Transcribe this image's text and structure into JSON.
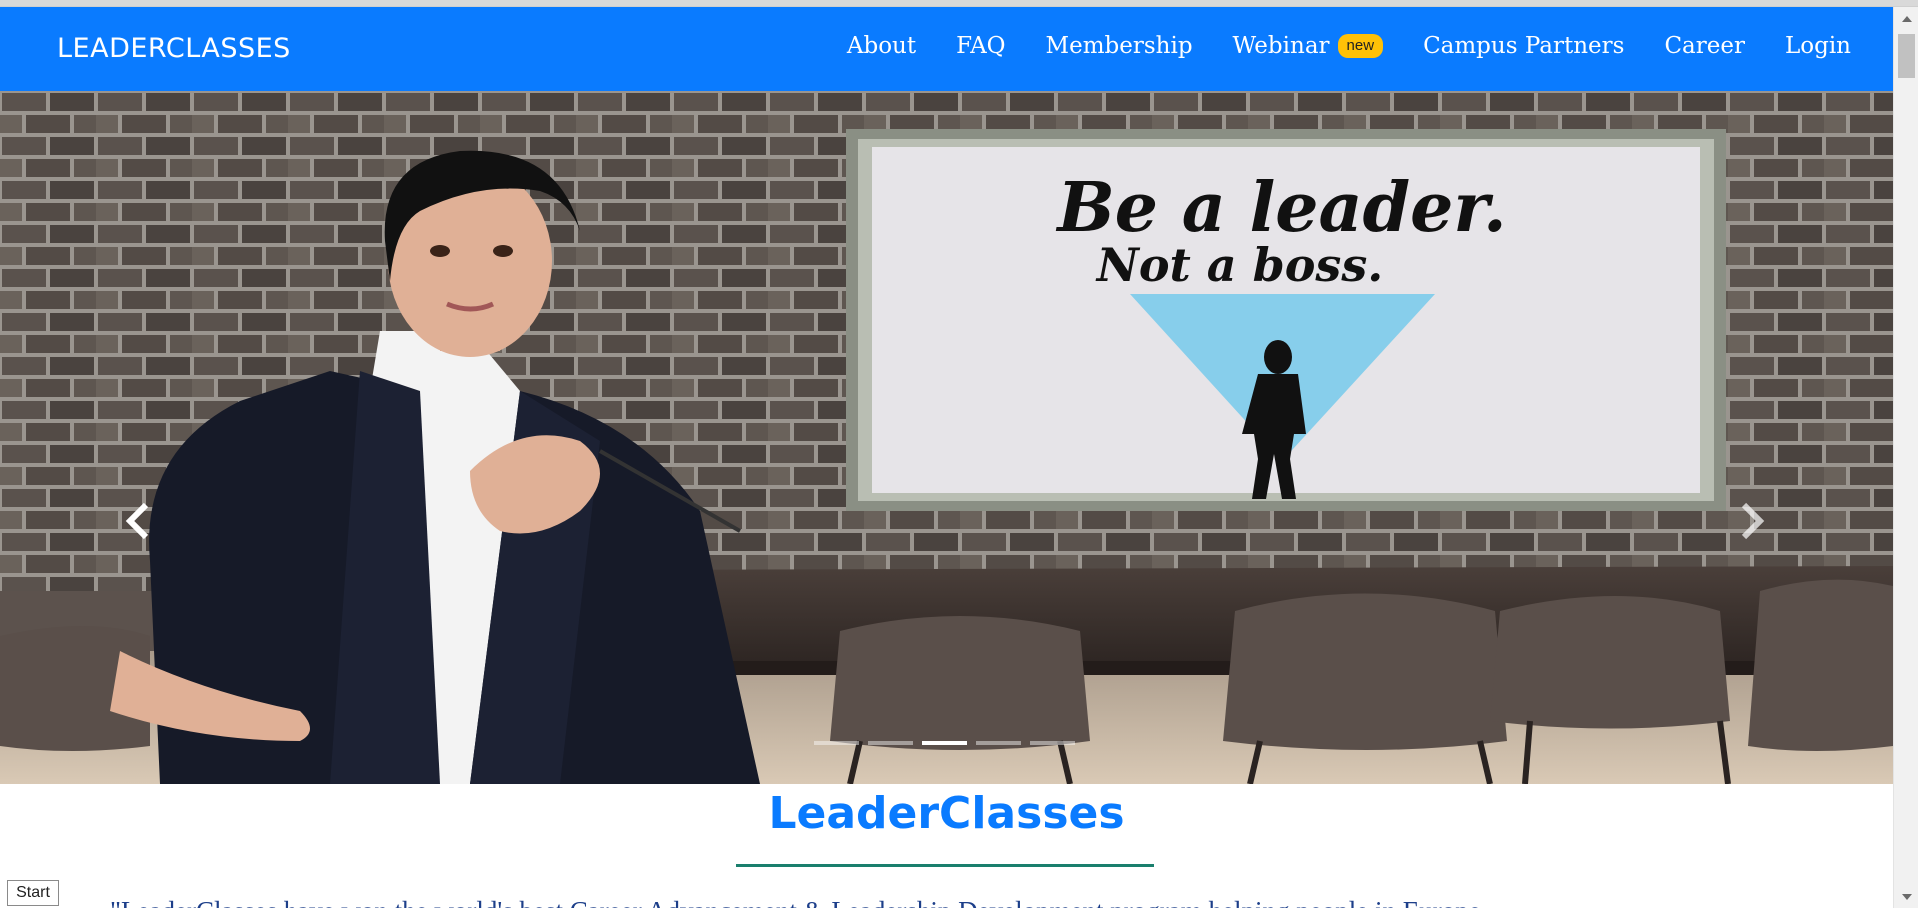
{
  "brand": {
    "name": "LEADERCLASSES"
  },
  "nav": {
    "items": [
      {
        "label": "About"
      },
      {
        "label": "FAQ"
      },
      {
        "label": "Membership"
      },
      {
        "label": "Webinar",
        "badge": "new"
      },
      {
        "label": "Campus Partners"
      },
      {
        "label": "Career"
      },
      {
        "label": "Login"
      }
    ]
  },
  "carousel": {
    "board_line1": "Be a leader.",
    "board_line2": "Not a boss.",
    "slide_count": 5,
    "active_slide": 3,
    "prev_icon": "chevron-left-icon",
    "next_icon": "chevron-right-icon"
  },
  "section": {
    "title": "LeaderClasses",
    "intro": "\"LeaderClasses have won the world's best Career Advancement & Leadership Development program helping people in Europe"
  },
  "start_button": {
    "label": "Start"
  },
  "colors": {
    "navbar": "#0a7bff",
    "badge": "#ffc107",
    "title": "#0a7bff",
    "rule": "#1a7f6d",
    "intro_text": "#1d3f8a"
  }
}
